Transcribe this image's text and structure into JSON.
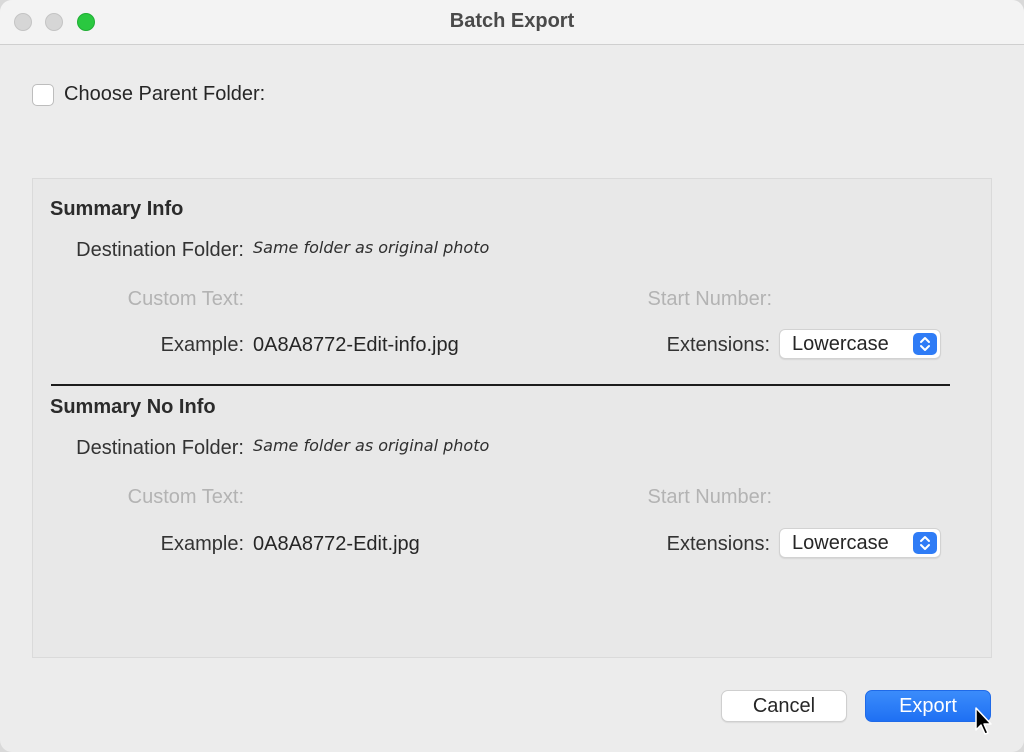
{
  "window": {
    "title": "Batch Export"
  },
  "parent_folder": {
    "label": "Choose Parent Folder:",
    "checked": false
  },
  "sections": [
    {
      "title": "Summary Info",
      "destination_label": "Destination Folder:",
      "destination_value": "Same folder as original photo",
      "custom_text_label": "Custom Text:",
      "start_number_label": "Start Number:",
      "example_label": "Example:",
      "example_value": "0A8A8772-Edit-info.jpg",
      "extensions_label": "Extensions:",
      "extensions_value": "Lowercase"
    },
    {
      "title": "Summary No Info",
      "destination_label": "Destination Folder:",
      "destination_value": "Same folder as original photo",
      "custom_text_label": "Custom Text:",
      "start_number_label": "Start Number:",
      "example_label": "Example:",
      "example_value": "0A8A8772-Edit.jpg",
      "extensions_label": "Extensions:",
      "extensions_value": "Lowercase"
    }
  ],
  "buttons": {
    "cancel": "Cancel",
    "export": "Export"
  },
  "colors": {
    "accent": "#2f7cf6",
    "maximize": "#2ac840"
  }
}
